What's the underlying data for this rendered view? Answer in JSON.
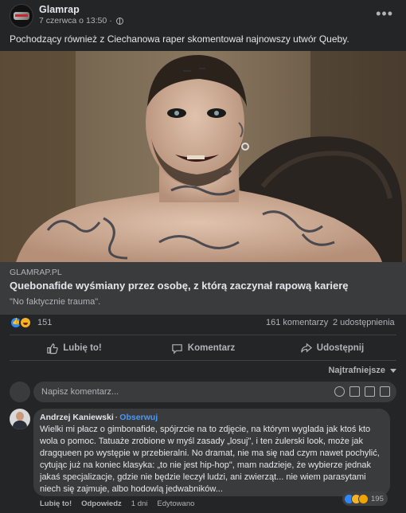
{
  "post": {
    "page_name": "Glamrap",
    "date": "7 czerwca o 13:50",
    "separator": "·",
    "more_label": "•••",
    "text": "Pochodzący również z Ciechanowa raper skomentował najnowszy utwór Queby."
  },
  "link": {
    "domain": "GLAMRAP.PL",
    "title": "Quebonafide wyśmiany przez osobę, z którą zaczynał rapową karierę",
    "description": "\"No faktycznie trauma\"."
  },
  "stats": {
    "reactions": [
      "like",
      "haha"
    ],
    "reaction_count": "151",
    "comments": "161 komentarzy",
    "shares": "2 udostępnienia"
  },
  "actions": {
    "like": "Lubię to!",
    "comment": "Komentarz",
    "share": "Udostępnij"
  },
  "sort": {
    "label": "Najtrafniejsze"
  },
  "comment_input": {
    "placeholder": "Napisz komentarz..."
  },
  "comment": {
    "author": "Andrzej Kaniewski",
    "follow": "Obserwuj",
    "text": "Wielki mi płacz o gimbonafide, spójrzcie na to zdjęcie, na którym wyglada jak ktoś kto wola o pomoc. Tatuaże zrobione w myśl zasady „losuj\", i ten żulerski look, może jak dragqueen po występie w przebieralni. No dramat, nie ma się nad czym nawet pochylić, cytując już na koniec klasyka: „to nie jest hip-hop\", mam nadzieje, że wybierze jednak jakaś specjalizacje, gdzie nie będzie leczył ludzi, ani zwierząt... nie wiem parasytami niech się zajmuje, albo hodowlą jedwabników...",
    "like_label": "Lubię to!",
    "reply_label": "Odpowiedz",
    "age": "1 dni",
    "edited": "Edytowano",
    "reactions": [
      "like",
      "haha",
      "wow"
    ],
    "reaction_count": "195"
  },
  "colors": {
    "background": "#242526",
    "surface": "#3a3b3c",
    "text_primary": "#e4e6eb",
    "text_secondary": "#b0b3b8",
    "link_blue": "#4599ff",
    "like_blue": "#2d88ff"
  }
}
